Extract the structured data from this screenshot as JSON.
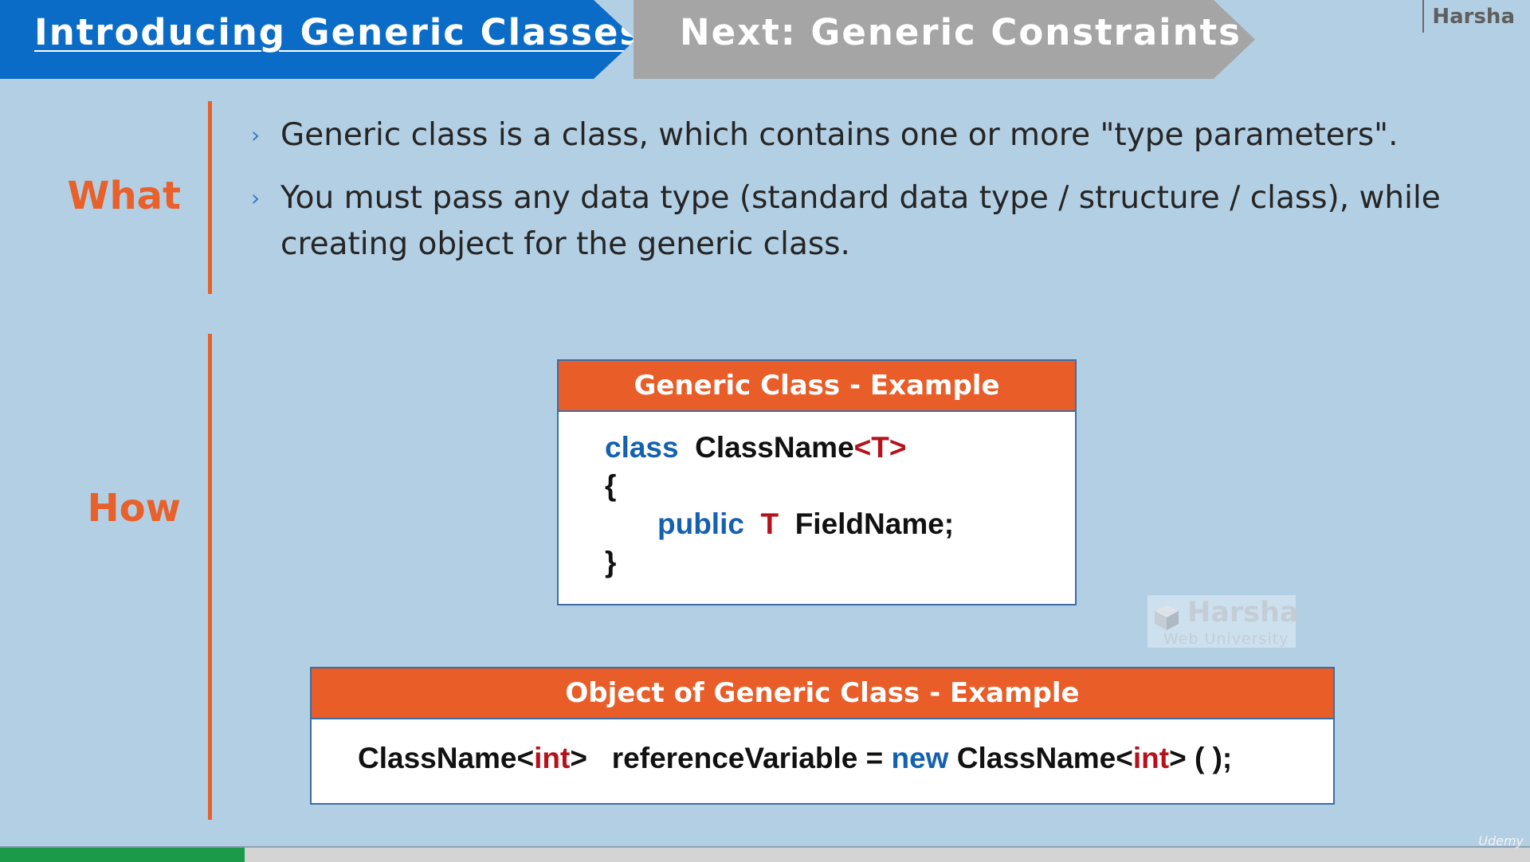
{
  "header": {
    "active_tab": "Introducing Generic Classes",
    "next_tab": "Next: Generic Constraints",
    "brand": "Harsha"
  },
  "sections": {
    "what_label": "What",
    "how_label": "How"
  },
  "what": {
    "bullets": [
      "Generic class is a class, which contains one or more \"type parameters\".",
      "You must pass any data type (standard data type / structure / class), while creating object for the generic class."
    ]
  },
  "example1": {
    "title": "Generic Class - Example",
    "kw_class": "class",
    "class_name": "ClassName",
    "type_param": "<T>",
    "open_brace": "{",
    "kw_public": "public",
    "field_type": "T",
    "field_name": "FieldName;",
    "close_brace": "}"
  },
  "example2": {
    "title": "Object of Generic Class - Example",
    "class_name1": "ClassName",
    "lt1": "<",
    "int1": "int",
    "gt1": ">",
    "ref": "referenceVariable =",
    "kw_new": "new",
    "class_name2": "ClassName",
    "lt2": "<",
    "int2": "int",
    "gt2": ">",
    "tail": "( );"
  },
  "watermark": {
    "name": "Harsha",
    "sub": "Web University"
  },
  "footer": {
    "progress": 0.16,
    "platform": "Udemy",
    "progress_color": "#1b9a4a"
  }
}
